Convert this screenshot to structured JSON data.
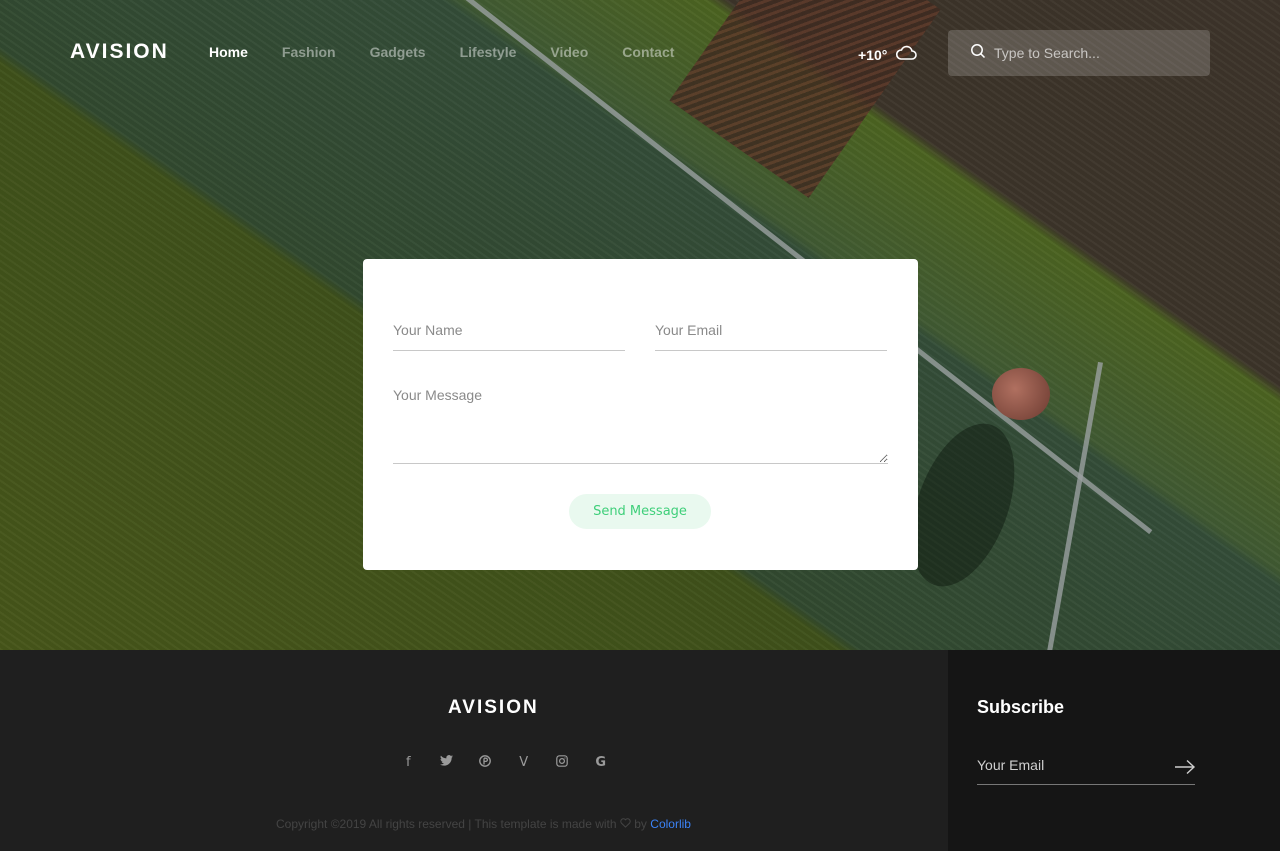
{
  "header": {
    "logo": "AVISION",
    "nav": [
      {
        "label": "Home",
        "active": true
      },
      {
        "label": "Fashion",
        "active": false
      },
      {
        "label": "Gadgets",
        "active": false
      },
      {
        "label": "Lifestyle",
        "active": false
      },
      {
        "label": "Video",
        "active": false
      },
      {
        "label": "Contact",
        "active": false
      }
    ],
    "weather": {
      "temp": "+10°",
      "icon": "cloud-icon"
    },
    "search": {
      "placeholder": "Type to Search...",
      "icon": "search-icon"
    }
  },
  "contact_form": {
    "name_placeholder": "Your Name",
    "email_placeholder": "Your Email",
    "message_placeholder": "Your Message",
    "send_label": "Send Message"
  },
  "footer": {
    "logo": "AVISION",
    "socials": [
      {
        "name": "facebook-icon",
        "glyph": "f"
      },
      {
        "name": "twitter-icon",
        "glyph": "🐦"
      },
      {
        "name": "pinterest-icon",
        "glyph": "℗"
      },
      {
        "name": "vimeo-icon",
        "glyph": "V"
      },
      {
        "name": "instagram-icon",
        "glyph": "◎"
      },
      {
        "name": "google-icon",
        "glyph": "G"
      }
    ],
    "copyright_text": "Copyright ©2019 All rights reserved | This template is made with",
    "copyright_by": "by",
    "copyright_link": "Colorlib",
    "subscribe": {
      "title": "Subscribe",
      "email_placeholder": "Your Email",
      "submit_icon": "arrow-right-icon"
    }
  },
  "colors": {
    "accent_green": "#3fcf7a",
    "button_bg": "#e9f9ef",
    "footer_bg": "#1f1f1f",
    "subscribe_bg": "#151515",
    "link_blue": "#3b82f6"
  }
}
